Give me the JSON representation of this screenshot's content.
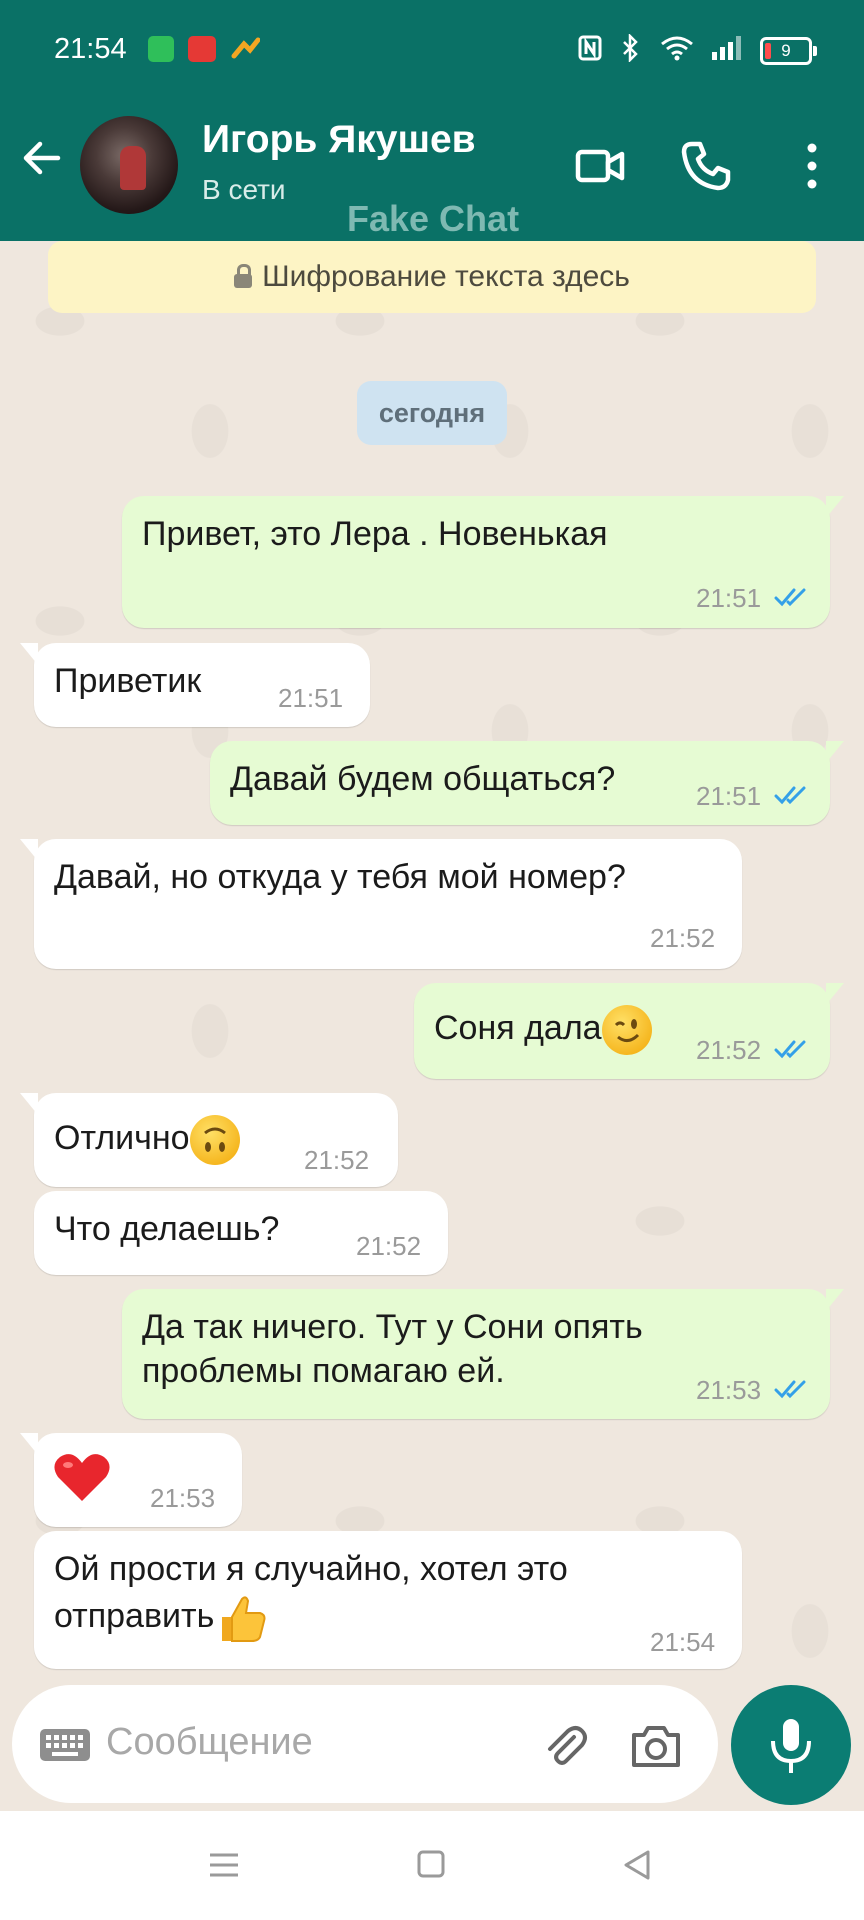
{
  "status_bar": {
    "time": "21:54",
    "battery_level": "9"
  },
  "header": {
    "contact_name": "Игорь Якушев",
    "contact_status": "В сети",
    "watermark": "Fake Chat"
  },
  "chat": {
    "encryption_notice": "Шифрование текста здесь",
    "date_label": "сегодня",
    "messages": [
      {
        "dir": "out",
        "text": "Привет, это Лера . Новенькая",
        "time": "21:51",
        "status": "read"
      },
      {
        "dir": "in",
        "text": "Приветик",
        "time": "21:51"
      },
      {
        "dir": "out",
        "text": "Давай будем общаться?",
        "time": "21:51",
        "status": "read"
      },
      {
        "dir": "in",
        "text": "Давай, но откуда у тебя мой номер?",
        "time": "21:52"
      },
      {
        "dir": "out",
        "text": "Соня дала",
        "emoji": "winking-face",
        "time": "21:52",
        "status": "read"
      },
      {
        "dir": "in",
        "text": "Отлично",
        "emoji": "upside-down-face",
        "time": "21:52"
      },
      {
        "dir": "in",
        "text": "Что делаешь?",
        "time": "21:52"
      },
      {
        "dir": "out",
        "text_lines": [
          "Да так ничего. Тут у Сони опять",
          "проблемы помагаю ей."
        ],
        "time": "21:53",
        "status": "read"
      },
      {
        "dir": "in",
        "emoji": "red-heart",
        "time": "21:53"
      },
      {
        "dir": "in",
        "text_lines": [
          "Ой прости я случайно, хотел это",
          "отправить"
        ],
        "emoji": "thumbs-up",
        "time": "21:54"
      }
    ]
  },
  "composer": {
    "placeholder": "Сообщение"
  },
  "colors": {
    "header_bg": "#0a7166",
    "outgoing_bubble": "#e6fbd3",
    "incoming_bubble": "#ffffff",
    "read_ticks": "#34a0e8",
    "mic_button": "#0b7d73"
  }
}
